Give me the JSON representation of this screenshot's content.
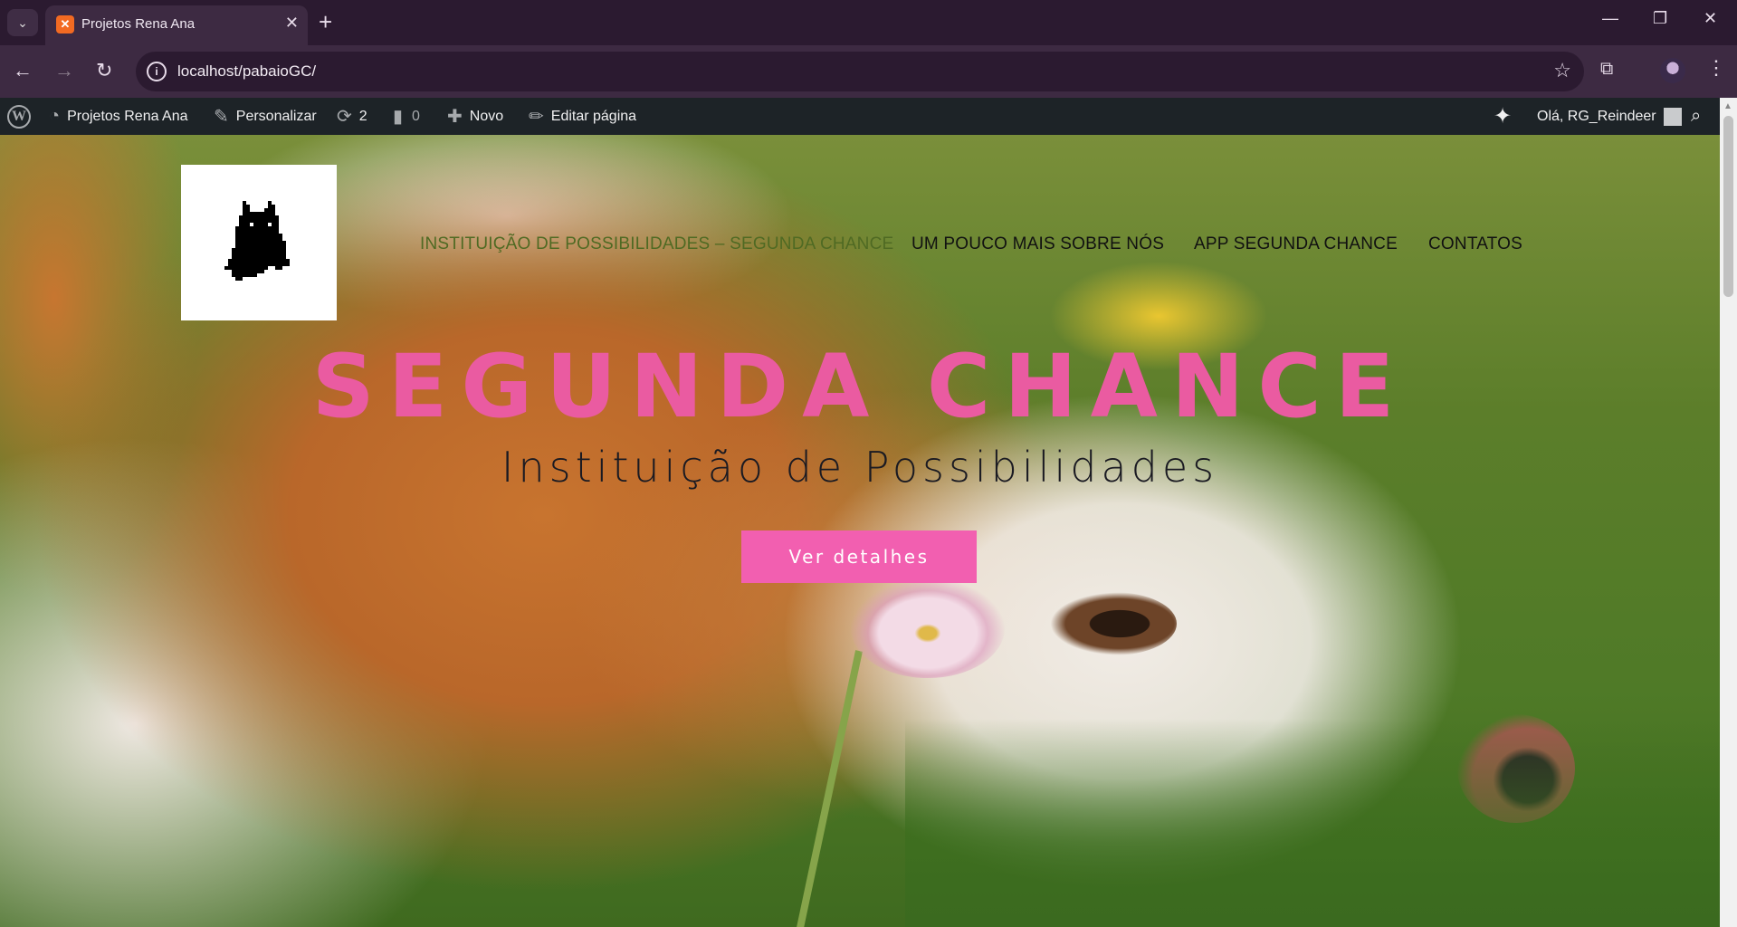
{
  "browser": {
    "tab_title": "Projetos Rena Ana",
    "tab_favicon": "xampp-icon",
    "url": "localhost/pabaioGC/"
  },
  "adminbar": {
    "site_name": "Projetos Rena Ana",
    "customize": "Personalizar",
    "updates_count": "2",
    "comments_count": "0",
    "new": "Novo",
    "edit_page": "Editar página",
    "greeting": "Olá, RG_Reindeer"
  },
  "site": {
    "nav": [
      {
        "label": "INSTITUIÇÃO DE POSSIBILIDADES – SEGUNDA CHANCE"
      },
      {
        "label": "UM POUCO MAIS SOBRE NÓS"
      },
      {
        "label": "APP SEGUNDA CHANCE"
      },
      {
        "label": "CONTATOS"
      }
    ],
    "hero_title": "SEGUNDA CHANCE",
    "hero_subtitle": "Instituição de Possibilidades",
    "hero_button": "Ver detalhes"
  },
  "colors": {
    "accent_pink": "#ea5ba1",
    "button_pink": "#f25fb0",
    "nav_active": "#4f6a23",
    "adminbar_bg": "#1d2327"
  }
}
